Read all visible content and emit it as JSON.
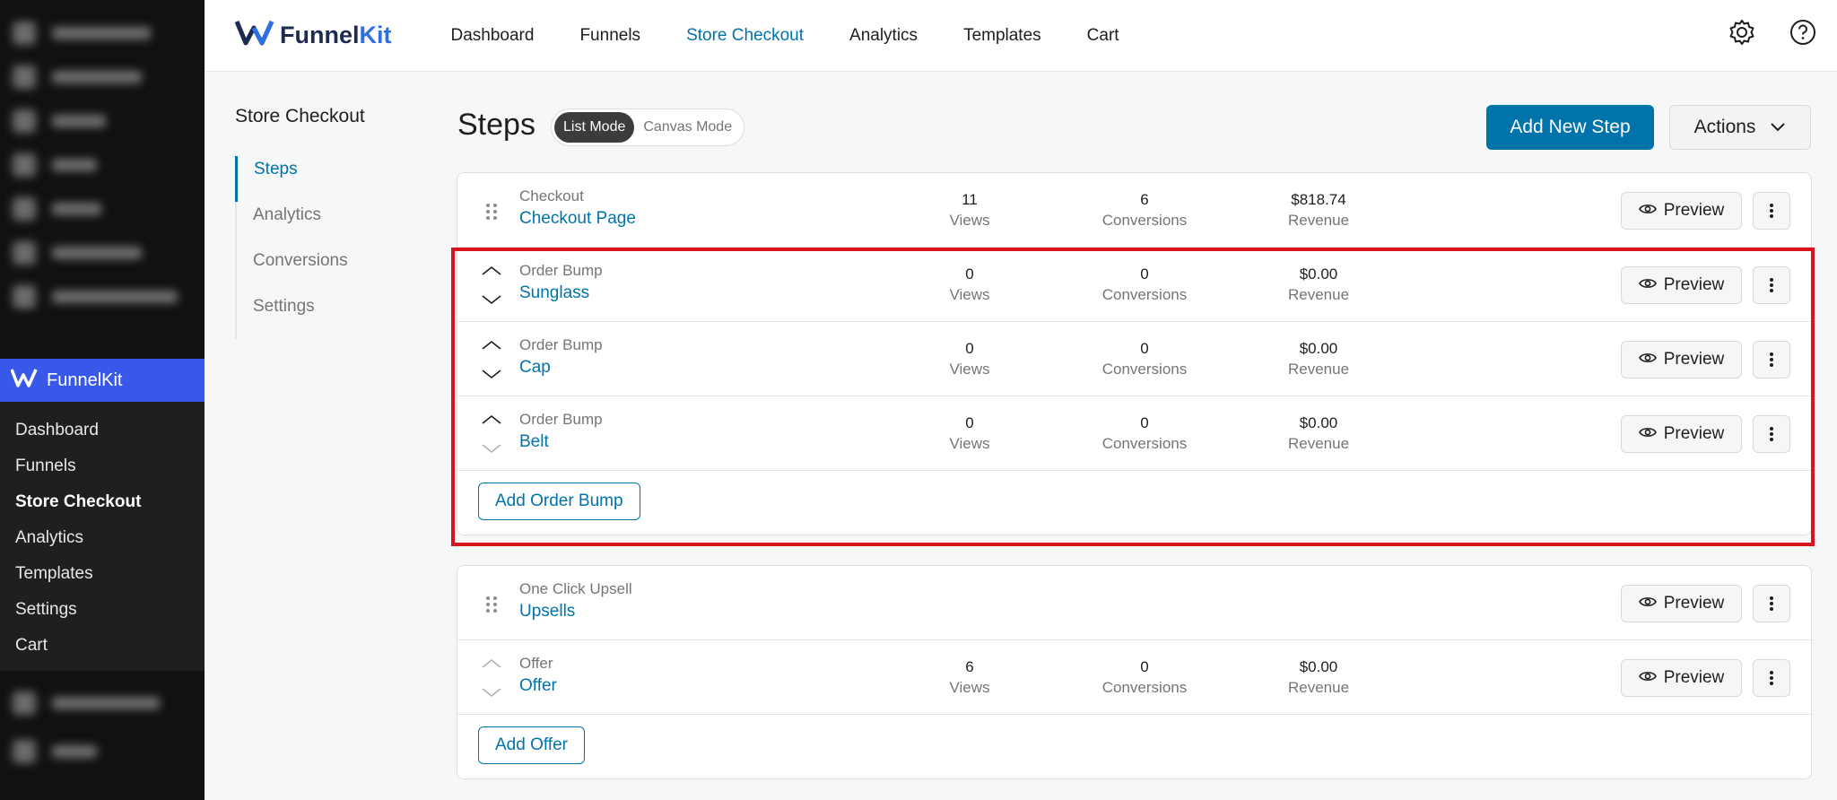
{
  "sidebar": {
    "brand_label": "FunnelKit",
    "items": [
      "Dashboard",
      "Funnels",
      "Store Checkout",
      "Analytics",
      "Templates",
      "Settings",
      "Cart"
    ],
    "active_item": "Store Checkout"
  },
  "topbar": {
    "brand_prefix": "Funnel",
    "brand_suffix": "Kit",
    "nav": [
      "Dashboard",
      "Funnels",
      "Store Checkout",
      "Analytics",
      "Templates",
      "Cart"
    ],
    "active_nav": "Store Checkout",
    "icons": [
      "gear-icon",
      "help-icon"
    ]
  },
  "subnav": {
    "title": "Store Checkout",
    "items": [
      "Steps",
      "Analytics",
      "Conversions",
      "Settings"
    ],
    "active": "Steps"
  },
  "header": {
    "title": "Steps",
    "mode_list": "List Mode",
    "mode_canvas": "Canvas Mode",
    "add_step": "Add New Step",
    "actions": "Actions"
  },
  "labels": {
    "views": "Views",
    "conversions": "Conversions",
    "revenue": "Revenue",
    "preview": "Preview"
  },
  "checkout": {
    "type": "Checkout",
    "name": "Checkout Page",
    "views": "11",
    "conversions": "6",
    "revenue": "$818.74"
  },
  "bumps": [
    {
      "type": "Order Bump",
      "name": "Sunglass",
      "views": "0",
      "conversions": "0",
      "revenue": "$0.00"
    },
    {
      "type": "Order Bump",
      "name": "Cap",
      "views": "0",
      "conversions": "0",
      "revenue": "$0.00"
    },
    {
      "type": "Order Bump",
      "name": "Belt",
      "views": "0",
      "conversions": "0",
      "revenue": "$0.00"
    }
  ],
  "add_order_bump": "Add Order Bump",
  "upsell": {
    "type": "One Click Upsell",
    "name": "Upsells"
  },
  "offer": {
    "type": "Offer",
    "name": "Offer",
    "views": "6",
    "conversions": "0",
    "revenue": "$0.00"
  },
  "add_offer": "Add Offer",
  "colors": {
    "accent": "#0073aa",
    "wp_sidebar": "#111111",
    "funnelkit_blue": "#3858e9",
    "highlight": "#d9141d"
  }
}
